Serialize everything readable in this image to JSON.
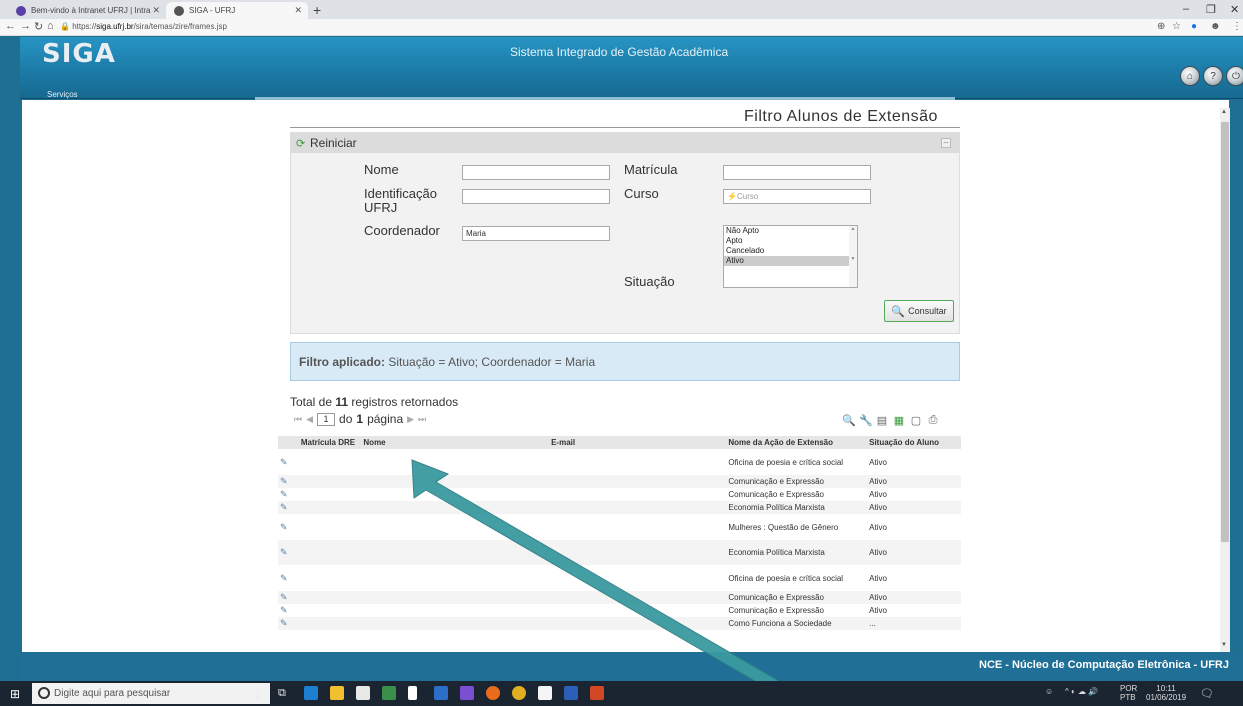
{
  "browser": {
    "tabs": [
      {
        "title": "Bem-vindo à Intranet UFRJ | Intra"
      },
      {
        "title": "SIGA - UFRJ"
      }
    ],
    "url_prefix": "https://",
    "url_host": "siga.ufrj.br",
    "url_path": "/sira/temas/zire/frames.jsp"
  },
  "app": {
    "logo": "SIGA",
    "logo_sub": "Serviços",
    "system_title": "Sistema Integrado de Gestão Acadêmica",
    "footer": "NCE - Núcleo de Computação Eletrônica - UFRJ"
  },
  "page": {
    "title": "Filtro Alunos de Extensão"
  },
  "filter": {
    "reset_label": "Reiniciar",
    "nome_label": "Nome",
    "nome_value": "",
    "matricula_label": "Matrícula",
    "matricula_value": "",
    "ident_label_1": "Identificação",
    "ident_label_2": "UFRJ",
    "ident_value": "",
    "curso_label": "Curso",
    "curso_placeholder": "Curso",
    "coord_label": "Coordenador",
    "coord_value": "Maria",
    "situacao_label": "Situação",
    "situacao_options": [
      "Não Apto",
      "Apto",
      "Cancelado",
      "Ativo"
    ],
    "situacao_selected": "Ativo",
    "consultar_label": "Consultar"
  },
  "applied": {
    "prefix": "Filtro aplicado:",
    "text": " Situação = Ativo; Coordenador = Maria"
  },
  "results": {
    "total_prefix": "Total de ",
    "total_count": "11",
    "total_suffix": " registros retornados",
    "page_current": "1",
    "page_of": "do",
    "page_total": "1",
    "page_word": "página",
    "columns": [
      "Matrícula DRE",
      "Nome",
      "E-mail",
      "Nome da Ação de Extensão",
      "Situação do Aluno"
    ],
    "rows": [
      {
        "acao": "Oficina de poesia e crítica social",
        "situacao": "Ativo"
      },
      {
        "acao": "Comunicação e Expressão",
        "situacao": "Ativo"
      },
      {
        "acao": "Comunicação e Expressão",
        "situacao": "Ativo"
      },
      {
        "acao": "Economia Política Marxista",
        "situacao": "Ativo"
      },
      {
        "acao": "Mulheres : Questão de Gênero",
        "situacao": "Ativo"
      },
      {
        "acao": "Economia Política Marxista",
        "situacao": "Ativo"
      },
      {
        "acao": "Oficina de poesia e crítica social",
        "situacao": "Ativo"
      },
      {
        "acao": "Comunicação e Expressão",
        "situacao": "Ativo"
      },
      {
        "acao": "Comunicação e Expressão",
        "situacao": "Ativo"
      },
      {
        "acao": "Como Funciona a Sociedade",
        "situacao": "..."
      }
    ]
  },
  "taskbar": {
    "search_placeholder": "Digite aqui para pesquisar",
    "lang_1": "POR",
    "lang_2": "PTB",
    "time": "10:11",
    "date": "01/06/2019"
  },
  "colors": {
    "header_blue": "#1b79a5",
    "applied_bg": "#d9eaf7",
    "consult_border": "#57a957"
  }
}
